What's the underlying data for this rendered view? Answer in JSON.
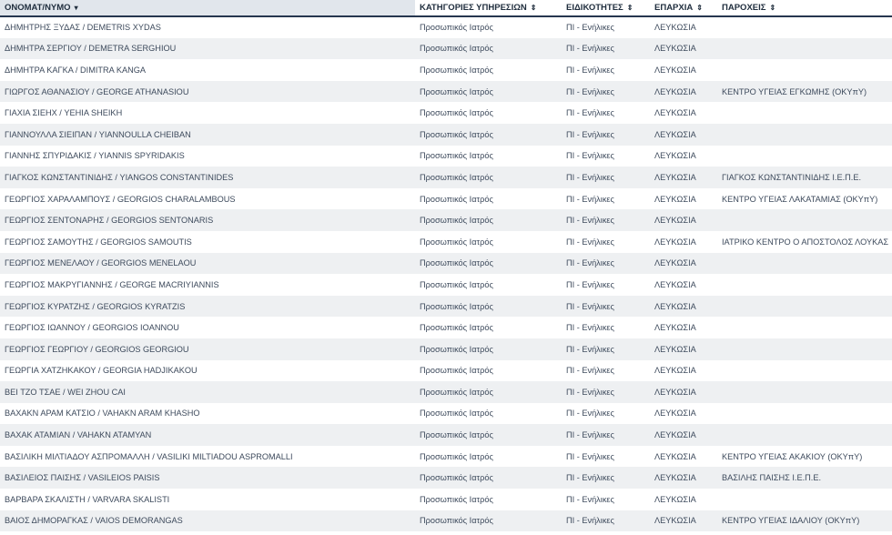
{
  "table": {
    "columns": [
      {
        "label": "ΟΝΟΜΑΤ/ΝΥΜΟ",
        "sort_icon": "▾"
      },
      {
        "label": "ΚΑΤΗΓΟΡΙΕΣ ΥΠΗΡΕΣΙΩΝ",
        "sort_icon": "⇕"
      },
      {
        "label": "ΕΙΔΙΚΟΤΗΤΕΣ",
        "sort_icon": "⇕"
      },
      {
        "label": "ΕΠΑΡΧΙΑ",
        "sort_icon": "⇕"
      },
      {
        "label": "ΠΑΡΟΧΕΙΣ",
        "sort_icon": "⇕"
      }
    ],
    "rows": [
      [
        "ΔΗΜΗΤΡΗΣ ΞΥΔΑΣ / DEMETRIS XYDAS",
        "Προσωπικός Ιατρός",
        "ΠΙ - Ενήλικες",
        "ΛΕΥΚΩΣΙΑ",
        ""
      ],
      [
        "ΔΗΜΗΤΡΑ ΣΕΡΓΙΟΥ / DEMETRA SERGHIOU",
        "Προσωπικός Ιατρός",
        "ΠΙ - Ενήλικες",
        "ΛΕΥΚΩΣΙΑ",
        ""
      ],
      [
        "ΔΗΜΗΤΡΑ ΚΑΓΚΑ / DIMITRA KANGA",
        "Προσωπικός Ιατρός",
        "ΠΙ - Ενήλικες",
        "ΛΕΥΚΩΣΙΑ",
        ""
      ],
      [
        "ΓΙΩΡΓΟΣ ΑΘΑΝΑΣΙΟΥ / GEORGE ATHANASIOU",
        "Προσωπικός Ιατρός",
        "ΠΙ - Ενήλικες",
        "ΛΕΥΚΩΣΙΑ",
        "ΚΕΝΤΡΟ ΥΓΕΙΑΣ ΕΓΚΩΜΗΣ (ΟΚΥπΥ)"
      ],
      [
        "ΓΙΑΧΙΑ ΣΙΕΗΧ / YEHIA SHEIKH",
        "Προσωπικός Ιατρός",
        "ΠΙ - Ενήλικες",
        "ΛΕΥΚΩΣΙΑ",
        ""
      ],
      [
        "ΓΙΑΝΝΟΥΛΛΑ ΣΙΕΙΠΑΝ / YIANNOULLA CHEIBAN",
        "Προσωπικός Ιατρός",
        "ΠΙ - Ενήλικες",
        "ΛΕΥΚΩΣΙΑ",
        ""
      ],
      [
        "ΓΙΑΝΝΗΣ ΣΠΥΡΙΔΑΚΙΣ / YIANNIS SPYRIDAKIS",
        "Προσωπικός Ιατρός",
        "ΠΙ - Ενήλικες",
        "ΛΕΥΚΩΣΙΑ",
        ""
      ],
      [
        "ΓΙΑΓΚΟΣ ΚΩΝΣΤΑΝΤΙΝΙΔΗΣ / YIANGOS CONSTANTINIDES",
        "Προσωπικός Ιατρός",
        "ΠΙ - Ενήλικες",
        "ΛΕΥΚΩΣΙΑ",
        "ΓΙΑΓΚΟΣ ΚΩΝΣΤΑΝΤΙΝΙΔΗΣ Ι.Ε.Π.Ε."
      ],
      [
        "ΓΕΩΡΓΙΟΣ ΧΑΡΑΛΑΜΠΟΥΣ / GEORGIOS CHARALAMBOUS",
        "Προσωπικός Ιατρός",
        "ΠΙ - Ενήλικες",
        "ΛΕΥΚΩΣΙΑ",
        "ΚΕΝΤΡΟ ΥΓΕΙΑΣ ΛΑΚΑΤΑΜΙΑΣ (ΟΚΥπΥ)"
      ],
      [
        "ΓΕΩΡΓΙΟΣ ΣΕΝΤΟΝΑΡΗΣ / GEORGIOS SENTONARIS",
        "Προσωπικός Ιατρός",
        "ΠΙ - Ενήλικες",
        "ΛΕΥΚΩΣΙΑ",
        ""
      ],
      [
        "ΓΕΩΡΓΙΟΣ ΣΑΜΟΥΤΗΣ / GEORGIOS SAMOUTIS",
        "Προσωπικός Ιατρός",
        "ΠΙ - Ενήλικες",
        "ΛΕΥΚΩΣΙΑ",
        "ΙΑΤΡΙΚΟ ΚΕΝΤΡΟ Ο ΑΠΟΣΤΟΛΟΣ ΛΟΥΚΑΣ"
      ],
      [
        "ΓΕΩΡΓΙΟΣ ΜΕΝΕΛΑΟΥ / GEORGIOS MENELAOU",
        "Προσωπικός Ιατρός",
        "ΠΙ - Ενήλικες",
        "ΛΕΥΚΩΣΙΑ",
        ""
      ],
      [
        "ΓΕΩΡΓΙΟΣ ΜΑΚΡΥΓΙΑΝΝΗΣ / GEORGE MACRIYIANNIS",
        "Προσωπικός Ιατρός",
        "ΠΙ - Ενήλικες",
        "ΛΕΥΚΩΣΙΑ",
        ""
      ],
      [
        "ΓΕΩΡΓΙΟΣ ΚΥΡΑΤΖΗΣ / GEORGIOS KYRATZIS",
        "Προσωπικός Ιατρός",
        "ΠΙ - Ενήλικες",
        "ΛΕΥΚΩΣΙΑ",
        ""
      ],
      [
        "ΓΕΩΡΓΙΟΣ ΙΩΑΝΝΟΥ / GEORGIOS IOANNOU",
        "Προσωπικός Ιατρός",
        "ΠΙ - Ενήλικες",
        "ΛΕΥΚΩΣΙΑ",
        ""
      ],
      [
        "ΓΕΩΡΓΙΟΣ ΓΕΩΡΓΙΟΥ / GEORGIOS GEORGIOU",
        "Προσωπικός Ιατρός",
        "ΠΙ - Ενήλικες",
        "ΛΕΥΚΩΣΙΑ",
        ""
      ],
      [
        "ΓΕΩΡΓΙΑ ΧΑΤΖΗΚΑΚΟΥ / GEORGIA HADJIKAKOU",
        "Προσωπικός Ιατρός",
        "ΠΙ - Ενήλικες",
        "ΛΕΥΚΩΣΙΑ",
        ""
      ],
      [
        "ΒΕΙ ΤΖΟ ΤΣΑΕ / WEI ZHOU CAI",
        "Προσωπικός Ιατρός",
        "ΠΙ - Ενήλικες",
        "ΛΕΥΚΩΣΙΑ",
        ""
      ],
      [
        "ΒΑΧΑΚΝ ΑΡΑΜ ΚΑΤΣΙΟ / VAHAKN ARAM KHASHO",
        "Προσωπικός Ιατρός",
        "ΠΙ - Ενήλικες",
        "ΛΕΥΚΩΣΙΑ",
        ""
      ],
      [
        "ΒΑΧΑΚ ΑΤΑΜΙΑΝ / VAHAKN ATAMYAN",
        "Προσωπικός Ιατρός",
        "ΠΙ - Ενήλικες",
        "ΛΕΥΚΩΣΙΑ",
        ""
      ],
      [
        "ΒΑΣΙΛΙΚΗ ΜΙΛΤΙΑΔΟΥ ΑΣΠΡΟΜΑΛΛΗ / VASILIKI MILTIADOU ASPROMALLI",
        "Προσωπικός Ιατρός",
        "ΠΙ - Ενήλικες",
        "ΛΕΥΚΩΣΙΑ",
        "ΚΕΝΤΡΟ ΥΓΕΙΑΣ ΑΚΑΚΙΟΥ (ΟΚΥπΥ)"
      ],
      [
        "ΒΑΣΙΛΕΙΟΣ ΠΑΙΣΗΣ / VASILEIOS PAISIS",
        "Προσωπικός Ιατρός",
        "ΠΙ - Ενήλικες",
        "ΛΕΥΚΩΣΙΑ",
        "ΒΑΣΙΛΗΣ ΠΑΙΣΗΣ Ι.Ε.Π.Ε."
      ],
      [
        "ΒΑΡΒΑΡΑ ΣΚΑΛΙΣΤΗ / VARVARA SKALISTI",
        "Προσωπικός Ιατρός",
        "ΠΙ - Ενήλικες",
        "ΛΕΥΚΩΣΙΑ",
        ""
      ],
      [
        "ΒΑΙΟΣ ΔΗΜΟΡΑΓΚΑΣ / VAIOS DEMORANGAS",
        "Προσωπικός Ιατρός",
        "ΠΙ - Ενήλικες",
        "ΛΕΥΚΩΣΙΑ",
        "ΚΕΝΤΡΟ ΥΓΕΙΑΣ ΙΔΑΛΙΟΥ (ΟΚΥπΥ)"
      ]
    ]
  }
}
